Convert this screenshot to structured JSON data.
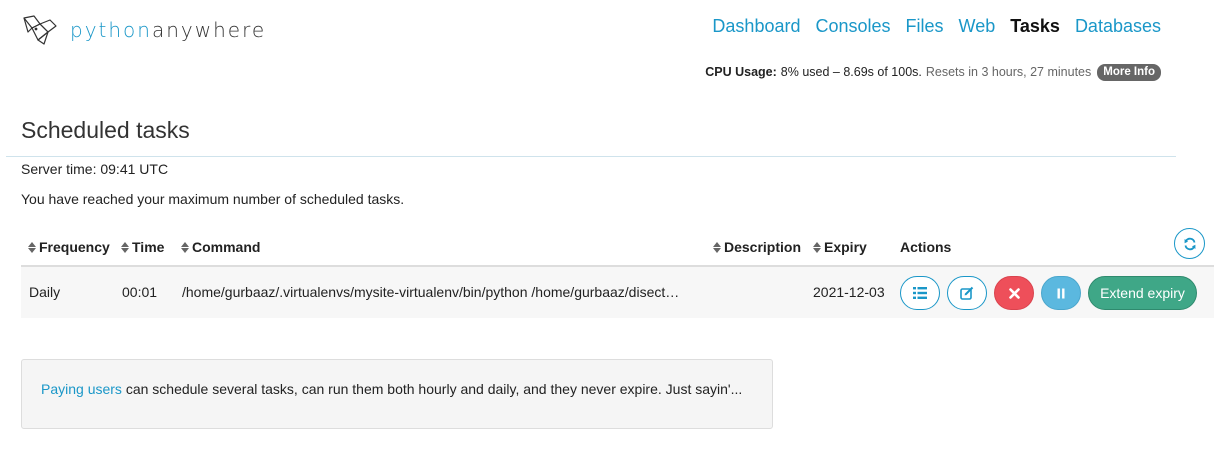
{
  "brand": {
    "part1": "python",
    "part2": "anywhere"
  },
  "nav": {
    "items": [
      {
        "label": "Dashboard",
        "active": false
      },
      {
        "label": "Consoles",
        "active": false
      },
      {
        "label": "Files",
        "active": false
      },
      {
        "label": "Web",
        "active": false
      },
      {
        "label": "Tasks",
        "active": true
      },
      {
        "label": "Databases",
        "active": false
      }
    ]
  },
  "cpu": {
    "label": "CPU Usage:",
    "value": "8% used – 8.69s of 100s.",
    "reset": "Resets in 3 hours, 27 minutes",
    "more_info": "More Info"
  },
  "page": {
    "title": "Scheduled tasks",
    "server_time": "Server time: 09:41 UTC",
    "limit_message": "You have reached your maximum number of scheduled tasks."
  },
  "table": {
    "headers": {
      "frequency": "Frequency",
      "time": "Time",
      "command": "Command",
      "description": "Description",
      "expiry": "Expiry",
      "actions": "Actions"
    },
    "rows": [
      {
        "frequency": "Daily",
        "time": "00:01",
        "command": "/home/gurbaaz/.virtualenvs/mysite-virtualenv/bin/python /home/gurbaaz/disect…",
        "description": "",
        "expiry": "2021-12-03",
        "extend_label": "Extend expiry"
      }
    ]
  },
  "upsell": {
    "link": "Paying users",
    "text": " can schedule several tasks, can run them both hourly and daily, and they never expire. Just sayin'..."
  },
  "colors": {
    "accent": "#1a97c8",
    "danger": "#ee4f5a",
    "info": "#5bb8df",
    "success": "#3fa787"
  },
  "icons": {
    "logo": "pythonanywhere-logo-icon",
    "refresh": "refresh-icon",
    "log": "list-icon",
    "edit": "edit-icon",
    "delete": "close-icon",
    "pause": "pause-icon"
  }
}
